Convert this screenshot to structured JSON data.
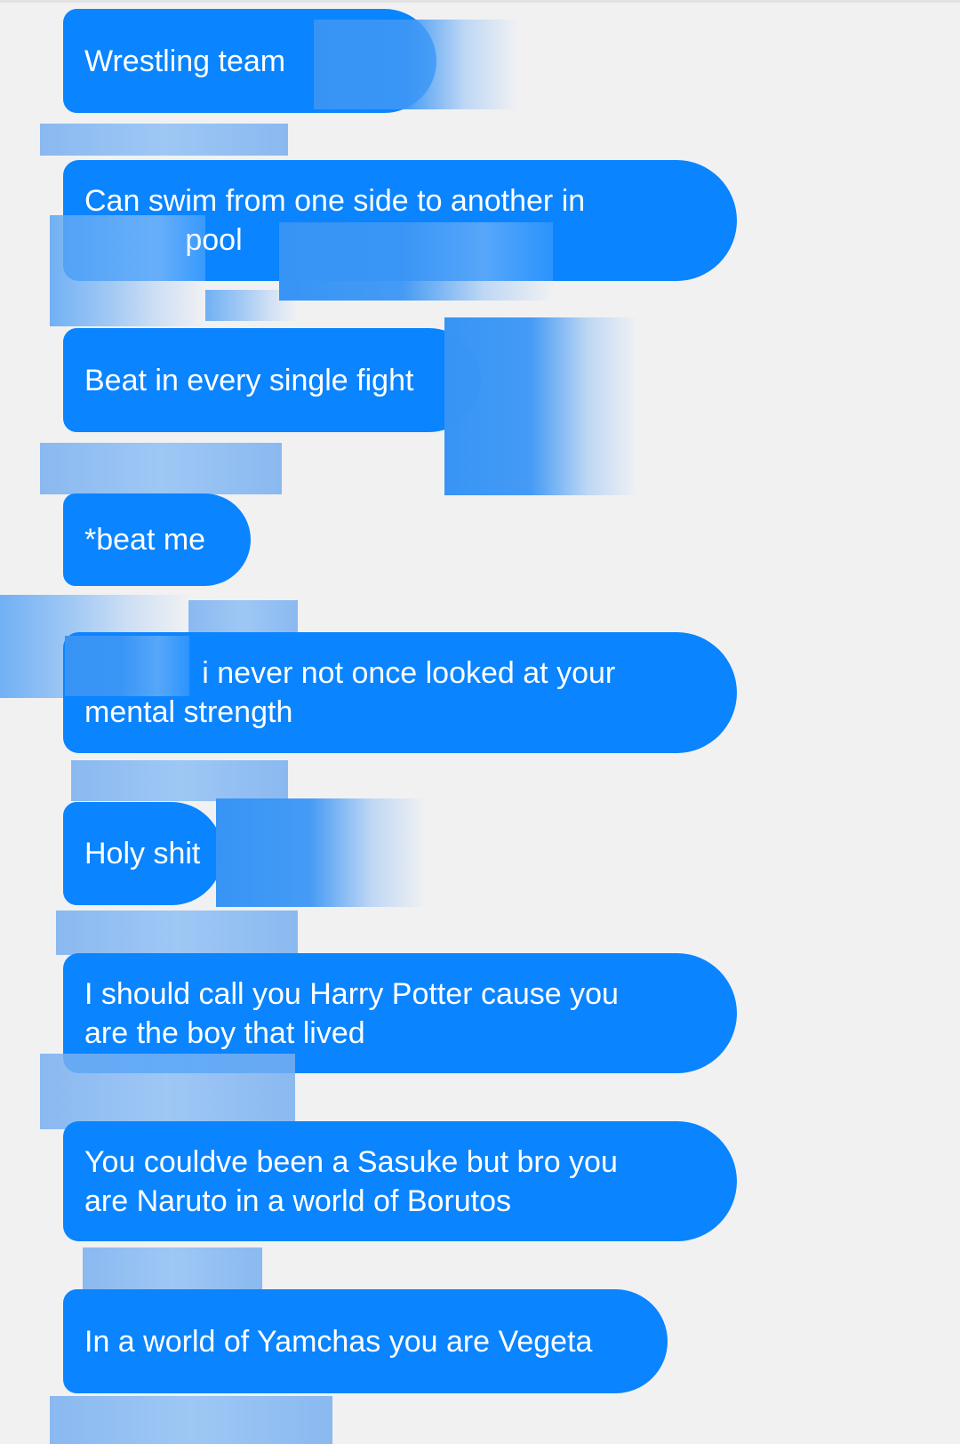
{
  "conversation": {
    "messages": [
      {
        "text": "Wrestling team"
      },
      {
        "text": "Can swim from one side to another in\n            pool"
      },
      {
        "text": "Beat in every single fight"
      },
      {
        "text": "*beat me"
      },
      {
        "text": "              i never not once looked at your\nmental strength"
      },
      {
        "text": "Holy shit"
      },
      {
        "text": "I should call you Harry Potter cause you\nare the boy that lived"
      },
      {
        "text": "You couldve been a Sasuke but bro you\nare Naruto in a world of Borutos"
      },
      {
        "text": "In a world of Yamchas you are Vegeta"
      }
    ]
  },
  "colors": {
    "background": "#f1f1f2",
    "bubble": "#0a84ff",
    "bubble_text": "#ffffff",
    "redaction": "#4a9cf5"
  }
}
